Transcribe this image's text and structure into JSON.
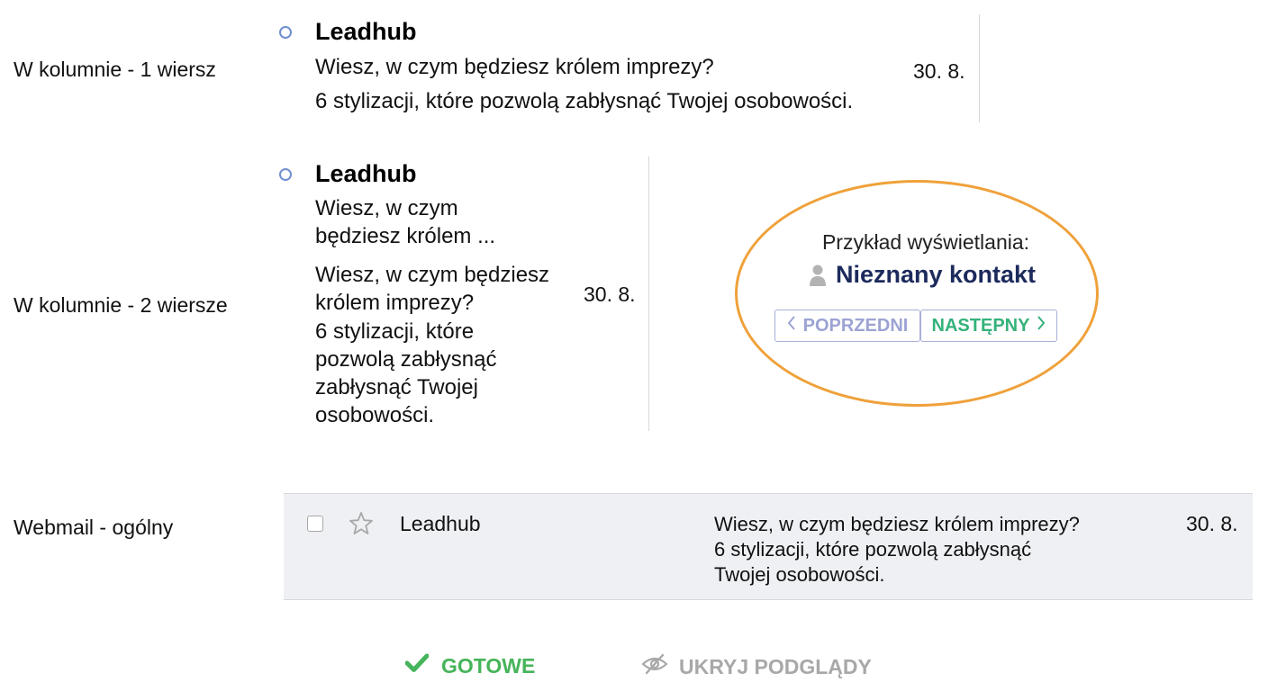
{
  "rows": {
    "row1_label": "W kolumnie - 1 wiersz",
    "row2_label": "W kolumnie - 2 wiersze",
    "row3_label": "Webmail - ogólny"
  },
  "preview1": {
    "sender": "Leadhub",
    "subject": "Wiesz, w czym będziesz królem imprezy?",
    "snippet": "6 stylizacji, które pozwolą zabłysnąć Twojej osobowości.",
    "date": "30. 8."
  },
  "preview2": {
    "sender": "Leadhub",
    "subject_line1": "Wiesz, w czym",
    "subject_line2": "będziesz królem ...",
    "body_line1": "Wiesz, w czym będziesz",
    "body_line2": "królem imprezy?",
    "body_line3": "6 stylizacji, które",
    "body_line4": "pozwolą zabłysnąć",
    "body_line5": "zabłysnąć Twojej",
    "body_line6": "osobowości.",
    "date": "30. 8."
  },
  "example": {
    "title": "Przykład wyświetlania:",
    "contact": "Nieznany kontakt",
    "contact_icon": "user-icon",
    "prev_label": "POPRZEDNI",
    "next_label": "NASTĘPNY",
    "accent": "#efa13a"
  },
  "webmail": {
    "sender": "Leadhub",
    "line1": "Wiesz, w czym będziesz królem imprezy?",
    "line2": "6 stylizacji, które pozwolą zabłysnąć",
    "line3": "Twojej osobowości.",
    "date": "30. 8."
  },
  "actions": {
    "done_label": "GOTOWE",
    "hide_label": "UKRYJ PODGLĄDY",
    "done_color": "#46b45a"
  }
}
